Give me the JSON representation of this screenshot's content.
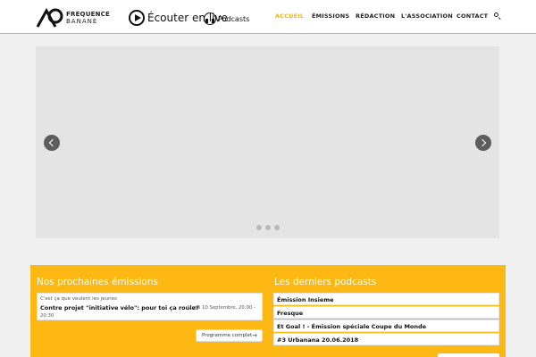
{
  "brand": {
    "line1": "FREQUENCE",
    "line2": "BANANE"
  },
  "header": {
    "live_label": "Écouter en live",
    "podcasts_label": "Podcasts",
    "nav": [
      {
        "label": "ACCUEIL",
        "active": true
      },
      {
        "label": "ÉMISSIONS",
        "active": false
      },
      {
        "label": "RÉDACTION",
        "active": false
      },
      {
        "label": "L'ASSOCIATION",
        "active": false
      },
      {
        "label": "CONTACT",
        "active": false
      }
    ]
  },
  "colors": {
    "accent": "#f3b40e",
    "band": "#fdb813",
    "slider_bg": "#e4e4e4"
  },
  "icons": {
    "search": "search-icon",
    "prev": "chevron-left-icon",
    "next": "chevron-right-icon",
    "play": "play-circle-icon",
    "headphones": "headphones-icon"
  },
  "slider": {
    "slide_count": 3
  },
  "upcoming": {
    "heading": "Nos prochaines émissions",
    "event": {
      "show": "C'est ça que veulent les jeunes",
      "title": "Contre projet \"initiative vélo\": pour toi ça roule?",
      "date": "Lundi 10 Septembre, 20:00 -",
      "time": "20:30"
    },
    "button_label": "Programme complet",
    "button_arrow": "→"
  },
  "podcasts": {
    "heading": "Les derniers podcasts",
    "items": [
      "Émission Insieme",
      "Fresque",
      "Et Goal ! - Émission spéciale Coupe du Monde",
      "#3 Urbanana 20.06.2018"
    ]
  }
}
